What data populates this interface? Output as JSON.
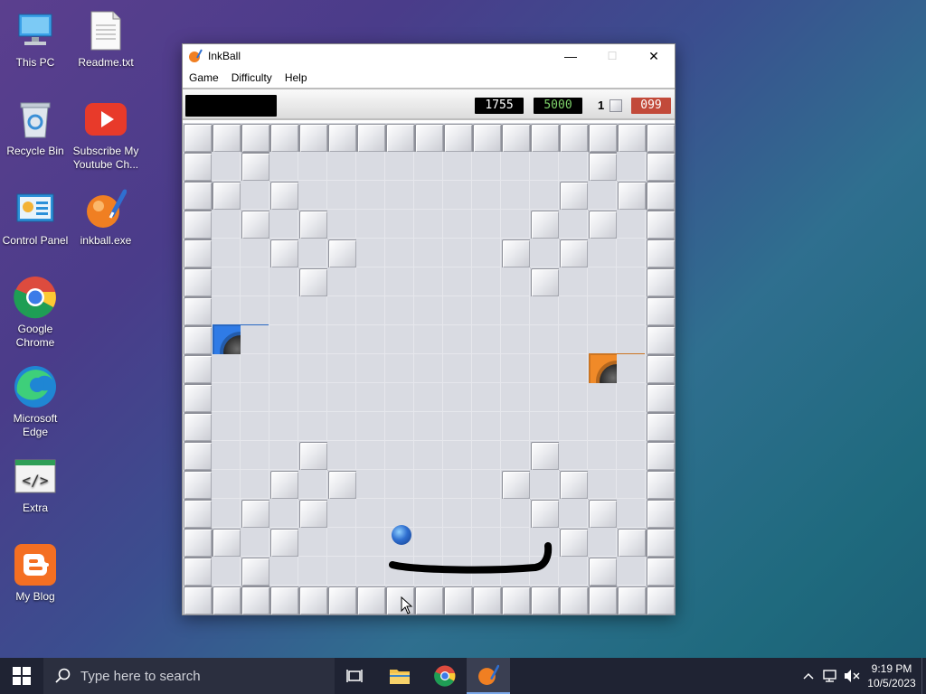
{
  "desktop": {
    "icons": [
      {
        "label": "This PC"
      },
      {
        "label": "Readme.txt"
      },
      {
        "label": "Recycle Bin"
      },
      {
        "label": "Subscribe My Youtube Ch..."
      },
      {
        "label": "Control Panel"
      },
      {
        "label": "inkball.exe"
      },
      {
        "label": "Google Chrome"
      },
      {
        "label": "Microsoft Edge"
      },
      {
        "label": "Extra"
      },
      {
        "label": "My Blog"
      }
    ]
  },
  "window": {
    "title": "InkBall",
    "minimize": "—",
    "maximize": "☐",
    "close": "✕"
  },
  "menu": {
    "game": "Game",
    "difficulty": "Difficulty",
    "help": "Help"
  },
  "scorebar": {
    "score": "1755",
    "target": "5000",
    "lives": "1",
    "timer": "099",
    "colors": {
      "target_text": "#7fd46b",
      "timer_bg": "#c24a3a"
    }
  },
  "board": {
    "rows": [
      [
        1,
        1,
        1,
        1,
        1,
        1,
        1,
        1,
        1,
        1,
        1,
        1,
        1,
        1,
        1,
        1,
        1
      ],
      [
        1,
        0,
        1,
        0,
        0,
        0,
        0,
        0,
        0,
        0,
        0,
        0,
        0,
        0,
        1,
        0,
        1
      ],
      [
        1,
        1,
        0,
        1,
        0,
        0,
        0,
        0,
        0,
        0,
        0,
        0,
        0,
        1,
        0,
        1,
        1
      ],
      [
        1,
        0,
        1,
        0,
        1,
        0,
        0,
        0,
        0,
        0,
        0,
        0,
        1,
        0,
        1,
        0,
        1
      ],
      [
        1,
        0,
        0,
        1,
        0,
        1,
        0,
        0,
        0,
        0,
        0,
        1,
        0,
        1,
        0,
        0,
        1
      ],
      [
        1,
        0,
        0,
        0,
        1,
        0,
        0,
        0,
        0,
        0,
        0,
        0,
        1,
        0,
        0,
        0,
        1
      ],
      [
        1,
        0,
        0,
        0,
        0,
        0,
        0,
        0,
        0,
        0,
        0,
        0,
        0,
        0,
        0,
        0,
        1
      ],
      [
        1,
        2,
        0,
        0,
        0,
        0,
        0,
        0,
        0,
        0,
        0,
        0,
        0,
        0,
        0,
        0,
        1
      ],
      [
        1,
        0,
        0,
        0,
        0,
        0,
        0,
        0,
        0,
        0,
        0,
        0,
        0,
        0,
        3,
        0,
        1
      ],
      [
        1,
        0,
        0,
        0,
        0,
        0,
        0,
        0,
        0,
        0,
        0,
        0,
        0,
        0,
        0,
        0,
        1
      ],
      [
        1,
        0,
        0,
        0,
        0,
        0,
        0,
        0,
        0,
        0,
        0,
        0,
        0,
        0,
        0,
        0,
        1
      ],
      [
        1,
        0,
        0,
        0,
        1,
        0,
        0,
        0,
        0,
        0,
        0,
        0,
        1,
        0,
        0,
        0,
        1
      ],
      [
        1,
        0,
        0,
        1,
        0,
        1,
        0,
        0,
        0,
        0,
        0,
        1,
        0,
        1,
        0,
        0,
        1
      ],
      [
        1,
        0,
        1,
        0,
        1,
        0,
        0,
        0,
        0,
        0,
        0,
        0,
        1,
        0,
        1,
        0,
        1
      ],
      [
        1,
        1,
        0,
        1,
        0,
        0,
        0,
        0,
        0,
        0,
        0,
        0,
        0,
        1,
        0,
        1,
        1
      ],
      [
        1,
        0,
        1,
        0,
        0,
        0,
        0,
        0,
        0,
        0,
        0,
        0,
        0,
        0,
        1,
        0,
        1
      ],
      [
        1,
        1,
        1,
        1,
        1,
        1,
        1,
        1,
        1,
        1,
        1,
        1,
        1,
        1,
        1,
        1,
        1
      ]
    ],
    "colors": {
      "blue_hole": "#2f7be6",
      "orange_hole": "#f08a28",
      "ball": "#2f6fd0",
      "ink": "#000000"
    }
  },
  "taskbar": {
    "search_placeholder": "Type here to search",
    "time": "9:19 PM",
    "date": "10/5/2023"
  }
}
